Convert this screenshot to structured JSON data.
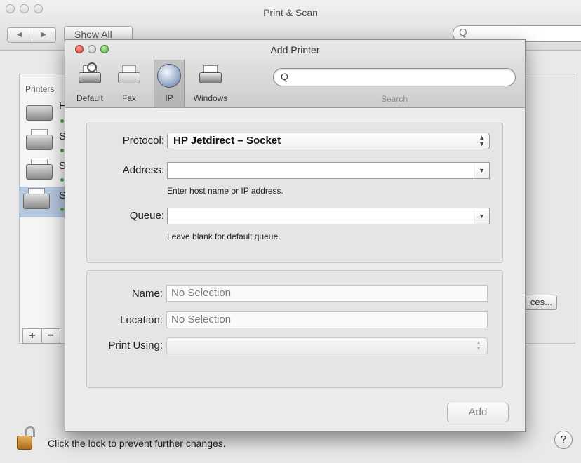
{
  "background_window": {
    "title": "Print & Scan",
    "nav_back": "◀",
    "nav_forward": "▶",
    "show_all_label": "Show All",
    "search_glyph": "Q",
    "printers_label": "Printers",
    "printer_list": [
      {
        "letter": "H",
        "icon": "laser-printer-icon",
        "status_color": "#3fa33f"
      },
      {
        "letter": "S",
        "icon": "printer-icon",
        "status_color": "#3fa33f"
      },
      {
        "letter": "S",
        "icon": "printer-icon",
        "status_color": "#3fa33f"
      },
      {
        "letter": "S",
        "icon": "printer-icon",
        "status_color": "#3fa33f",
        "selected": true
      }
    ],
    "add_label": "+",
    "remove_label": "−",
    "options_button_fragment": "ces...",
    "lock_text": "Click the lock to prevent further changes.",
    "help_label": "?"
  },
  "sheet": {
    "title": "Add Printer",
    "toolbar": {
      "items": [
        {
          "label": "Default",
          "icon": "default-printer-icon"
        },
        {
          "label": "Fax",
          "icon": "fax-icon"
        },
        {
          "label": "IP",
          "icon": "globe-icon",
          "active": true
        },
        {
          "label": "Windows",
          "icon": "windows-printer-icon"
        }
      ],
      "search_placeholder": "",
      "search_label": "Search"
    },
    "connection": {
      "protocol_label": "Protocol:",
      "protocol_value": "HP Jetdirect – Socket",
      "address_label": "Address:",
      "address_value": "",
      "address_hint": "Enter host name or IP address.",
      "queue_label": "Queue:",
      "queue_value": "",
      "queue_hint": "Leave blank for default queue."
    },
    "details": {
      "name_label": "Name:",
      "name_value": "No Selection",
      "location_label": "Location:",
      "location_value": "No Selection",
      "print_using_label": "Print Using:",
      "print_using_value": ""
    },
    "add_button_label": "Add"
  },
  "colors": {
    "close": "#d8392c",
    "maximize": "#4fa83a",
    "selection": "#b5c6dd"
  }
}
